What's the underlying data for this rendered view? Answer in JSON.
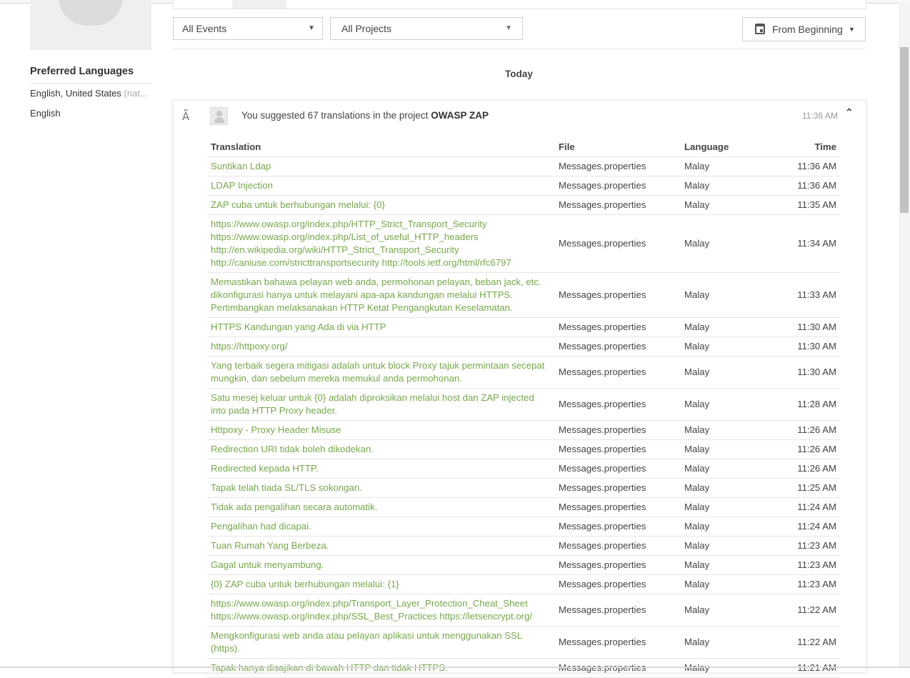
{
  "sidebar": {
    "preferred_languages_title": "Preferred Languages",
    "languages": [
      {
        "name": "English, United States",
        "note": "(nat..."
      },
      {
        "name": "English",
        "note": ""
      }
    ]
  },
  "filters": {
    "events": "All Events",
    "projects": "All Projects",
    "date_range": "From Beginning"
  },
  "day_header": "Today",
  "activity": {
    "summary_prefix": "You suggested 67 translations in the project",
    "project": "OWASP ZAP",
    "time": "11:36 AM",
    "columns": {
      "translation": "Translation",
      "file": "File",
      "language": "Language",
      "time": "Time"
    },
    "rows": [
      {
        "translation": "Suntikan Ldap",
        "file": "Messages.properties",
        "language": "Malay",
        "time": "11:36 AM"
      },
      {
        "translation": "LDAP Injection",
        "file": "Messages.properties",
        "language": "Malay",
        "time": "11:36 AM"
      },
      {
        "translation": "ZAP cuba untuk berhubungan melalui: {0}",
        "file": "Messages.properties",
        "language": "Malay",
        "time": "11:35 AM"
      },
      {
        "translation": "https://www.owasp.org/index.php/HTTP_Strict_Transport_Security https://www.owasp.org/index.php/List_of_useful_HTTP_headers http://en.wikipedia.org/wiki/HTTP_Strict_Transport_Security http://caniuse.com/stricttransportsecurity http://tools.ietf.org/html/rfc6797",
        "file": "Messages.properties",
        "language": "Malay",
        "time": "11:34 AM"
      },
      {
        "translation": "Memastikan bahawa pelayan web anda, permohonan pelayan, beban jack, etc. dikonfigurasi hanya untuk melayani apa-apa kandungan melalui HTTPS. Pertimbangkan melaksanakan HTTP Ketat Pengangkutan Keselamatan.",
        "file": "Messages.properties",
        "language": "Malay",
        "time": "11:33 AM"
      },
      {
        "translation": "HTTPS Kandungan yang Ada di via HTTP",
        "file": "Messages.properties",
        "language": "Malay",
        "time": "11:30 AM"
      },
      {
        "translation": "https://httpoxy.org/",
        "file": "Messages.properties",
        "language": "Malay",
        "time": "11:30 AM"
      },
      {
        "translation": "Yang terbaik segera mitigasi adalah untuk block Proxy tajuk permintaan secepat mungkin, dan sebelum mereka memukul anda permohonan.",
        "file": "Messages.properties",
        "language": "Malay",
        "time": "11:30 AM"
      },
      {
        "translation": "Satu mesej keluar untuk {0} adalah diproksikan melalui host dan ZAP injected into pada HTTP Proxy header.",
        "file": "Messages.properties",
        "language": "Malay",
        "time": "11:28 AM"
      },
      {
        "translation": "Httpoxy - Proxy Header Misuse",
        "file": "Messages.properties",
        "language": "Malay",
        "time": "11:26 AM"
      },
      {
        "translation": "Redirection URI tidak boleh dikodekan.",
        "file": "Messages.properties",
        "language": "Malay",
        "time": "11:26 AM"
      },
      {
        "translation": "Redirected kepada HTTP.",
        "file": "Messages.properties",
        "language": "Malay",
        "time": "11:26 AM"
      },
      {
        "translation": "Tapak telah tiada SL/TLS sokongan.",
        "file": "Messages.properties",
        "language": "Malay",
        "time": "11:25 AM"
      },
      {
        "translation": "Tidak ada pengalihan secara automatik.",
        "file": "Messages.properties",
        "language": "Malay",
        "time": "11:24 AM"
      },
      {
        "translation": "Pengalihan had dicapai.",
        "file": "Messages.properties",
        "language": "Malay",
        "time": "11:24 AM"
      },
      {
        "translation": "Tuan Rumah Yang Berbeza.",
        "file": "Messages.properties",
        "language": "Malay",
        "time": "11:23 AM"
      },
      {
        "translation": "Gagal untuk menyambung.",
        "file": "Messages.properties",
        "language": "Malay",
        "time": "11:23 AM"
      },
      {
        "translation": "{0} ZAP cuba untuk berhubungan melalui: {1}",
        "file": "Messages.properties",
        "language": "Malay",
        "time": "11:23 AM"
      },
      {
        "translation": "https://www.owasp.org/index.php/Transport_Layer_Protection_Cheat_Sheet https://www.owasp.org/index.php/SSL_Best_Practices https://letsencrypt.org/",
        "file": "Messages.properties",
        "language": "Malay",
        "time": "11:22 AM"
      },
      {
        "translation": "Mengkonfigurasi web anda atau pelayan aplikasi untuk menggunakan SSL (https).",
        "file": "Messages.properties",
        "language": "Malay",
        "time": "11:22 AM"
      },
      {
        "translation": "Tapak hanya disajikan di bawah HTTP dan tidak HTTPS.",
        "file": "Messages.properties",
        "language": "Malay",
        "time": "11:21 AM"
      }
    ]
  },
  "icons": {
    "translate": "translate-icon",
    "calendar": "calendar-icon",
    "collapse": "chevron-up-icon",
    "caret": "caret-down-icon",
    "avatar": "user-avatar-icon"
  },
  "colors": {
    "translation_text": "#76a84a",
    "muted": "#aaaaaa"
  }
}
